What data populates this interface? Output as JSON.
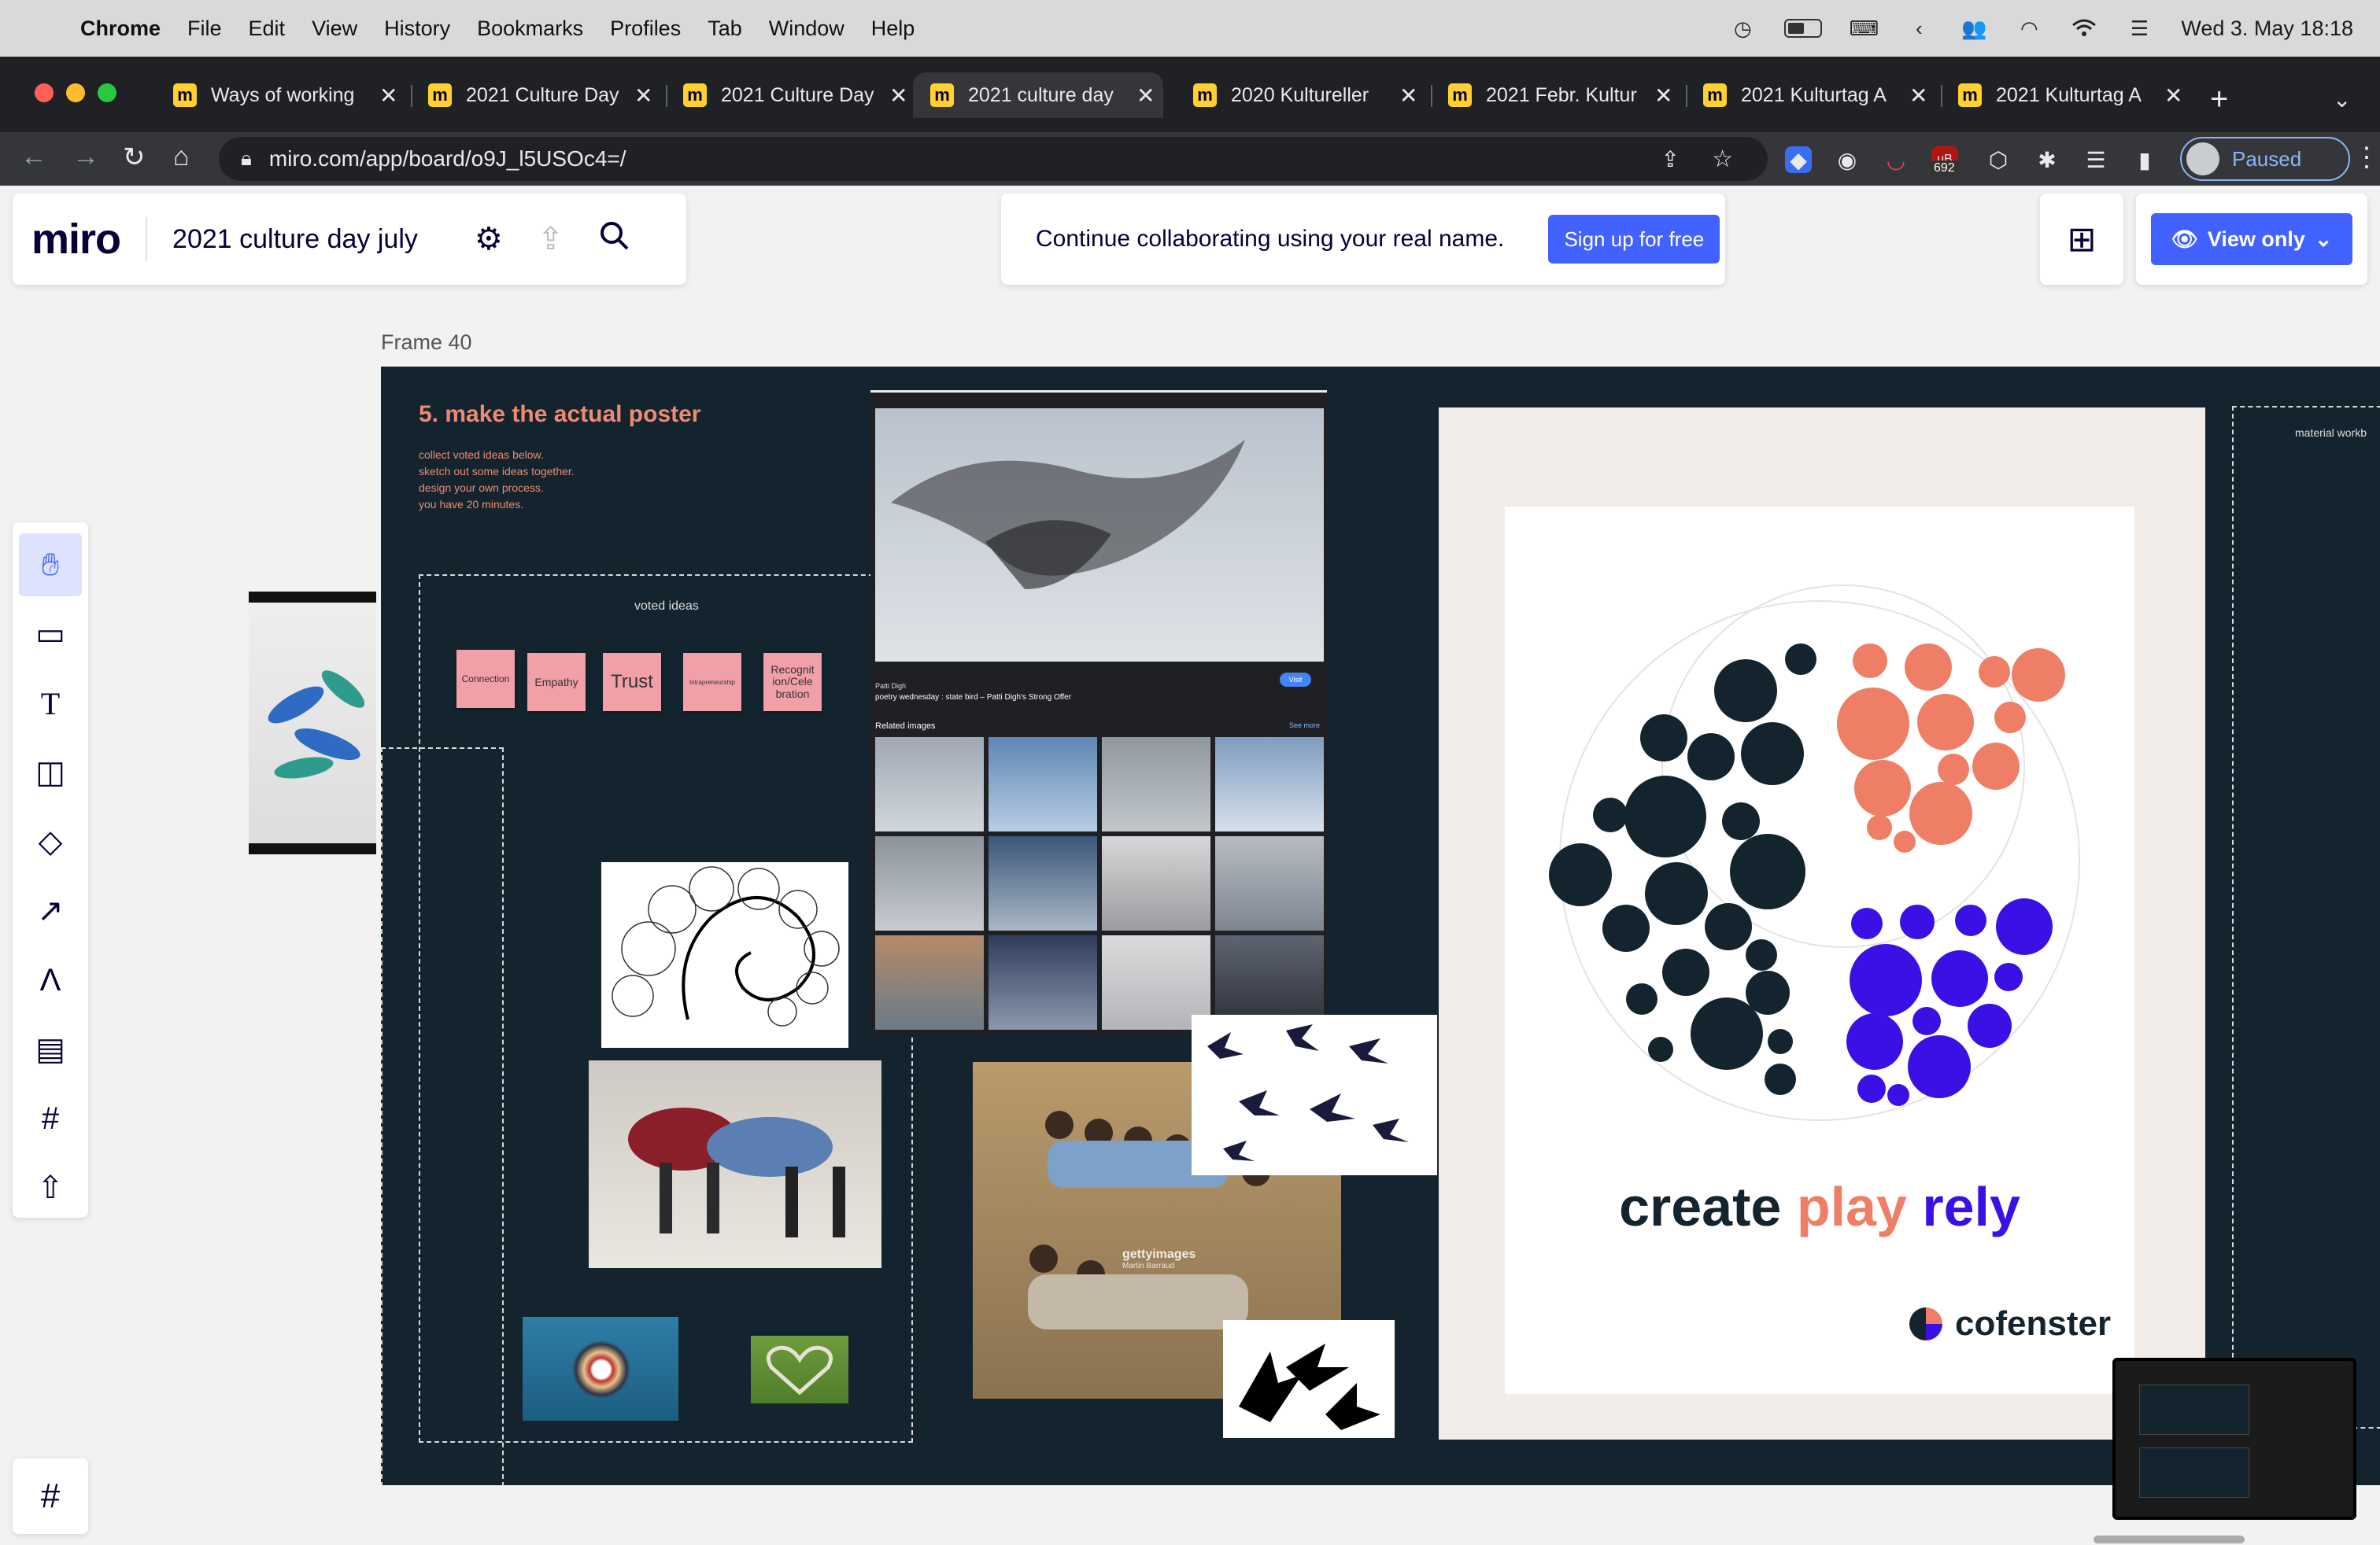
{
  "menubar": {
    "app": "Chrome",
    "items": [
      "File",
      "Edit",
      "View",
      "History",
      "Bookmarks",
      "Profiles",
      "Tab",
      "Window",
      "Help"
    ],
    "clock": "Wed 3. May  18:18"
  },
  "tabs": [
    {
      "title": "Ways of working",
      "active": false
    },
    {
      "title": "2021 Culture Day",
      "active": false
    },
    {
      "title": "2021 Culture Day",
      "active": false
    },
    {
      "title": "2021 culture day",
      "active": true
    },
    {
      "title": "2020 Kultureller",
      "active": false
    },
    {
      "title": "2021 Febr. Kultur",
      "active": false
    },
    {
      "title": "2021 Kulturtag A",
      "active": false
    },
    {
      "title": "2021 Kulturtag A",
      "active": false
    }
  ],
  "toolbar": {
    "url": "miro.com/app/board/o9J_l5USOc4=/",
    "badge_count": "692",
    "profile_status": "Paused"
  },
  "miro": {
    "logo": "miro",
    "board_title": "2021 culture day july",
    "signup_text": "Continue collaborating using your real name.",
    "signup_button": "Sign up for free",
    "view_button": "View only",
    "frame_label": "Frame 40"
  },
  "frame": {
    "heading": "5. make the actual poster",
    "instructions": [
      "collect voted ideas below.",
      "sketch out some ideas together.",
      "design your own process.",
      "you have 20 minutes."
    ],
    "voted_label": "voted ideas",
    "stickies": [
      "Connection",
      "Empathy",
      "Trust",
      "Intrapreneurship",
      "Recognit ion/Cele bration"
    ],
    "side_label": "material workb"
  },
  "image_search": {
    "caption_title": "poetry wednesday : state bird – Patti Digh's Strong Offer",
    "source": "Patti Digh",
    "visit": "Visit",
    "related": "Related images",
    "see_more": "See more"
  },
  "poster": {
    "tagline_1": "create",
    "tagline_2": "play",
    "tagline_3": "rely",
    "brand": "cofenster",
    "colors": {
      "dark": "#14242e",
      "coral": "#ee7f66",
      "violet": "#3a10e5"
    }
  },
  "getty": {
    "mark": "gettyimages",
    "credit": "Martin Barraud"
  }
}
